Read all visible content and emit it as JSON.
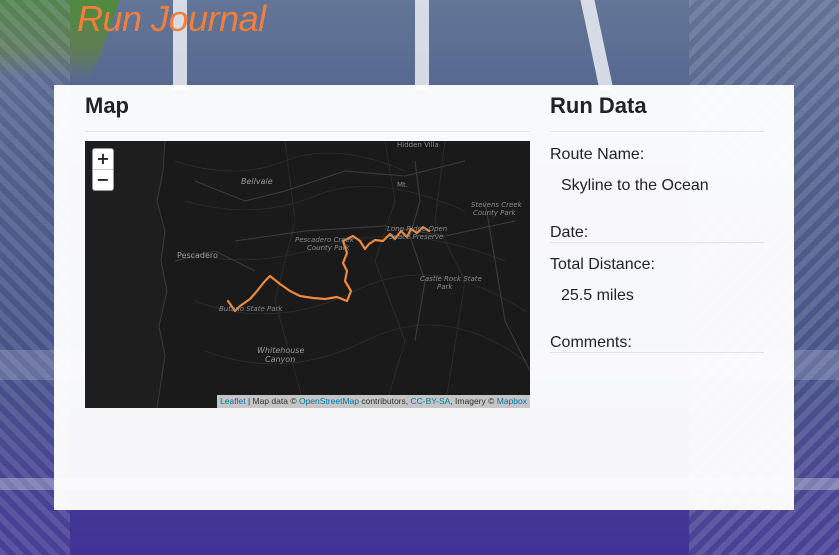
{
  "app": {
    "title": "Run Journal"
  },
  "map_section": {
    "heading": "Map",
    "zoom_in_label": "+",
    "zoom_out_label": "−",
    "place_labels": {
      "hidden_villa": "Hidden Villa",
      "bellvale": "Bellvale",
      "mt": "Mt.",
      "stevens_creek": "Stevens Creek",
      "county_park_1": "County Park",
      "pescadero_creek": "Pescadero Creek",
      "county_park_2": "County Park",
      "long_ridge": "Long Ridge Open",
      "space_preserve": "Space Preserve",
      "pescadero": "Pescadero",
      "castle_rock": "Castle Rock State",
      "park_1": "Park",
      "butano": "Butano State Park",
      "whitehouse": "Whitehouse",
      "canyon": "Canyon"
    },
    "attribution": {
      "leaflet": "Leaflet",
      "map_data": " | Map data © ",
      "osm": "OpenStreetMap",
      "contributors": " contributors, ",
      "ccbysa": "CC-BY-SA",
      "imagery": ", Imagery © ",
      "mapbox": "Mapbox"
    },
    "route_color": "#f08a3c"
  },
  "run_data": {
    "heading": "Run Data",
    "route_name_label": "Route Name:",
    "route_name_value": "Skyline to the Ocean",
    "date_label": "Date:",
    "date_value": "",
    "total_distance_label": "Total Distance:",
    "total_distance_value": "25.5 miles",
    "comments_label": "Comments:",
    "comments_value": ""
  },
  "colors": {
    "title_accent": "#f47f3a",
    "link": "#0078a8"
  }
}
